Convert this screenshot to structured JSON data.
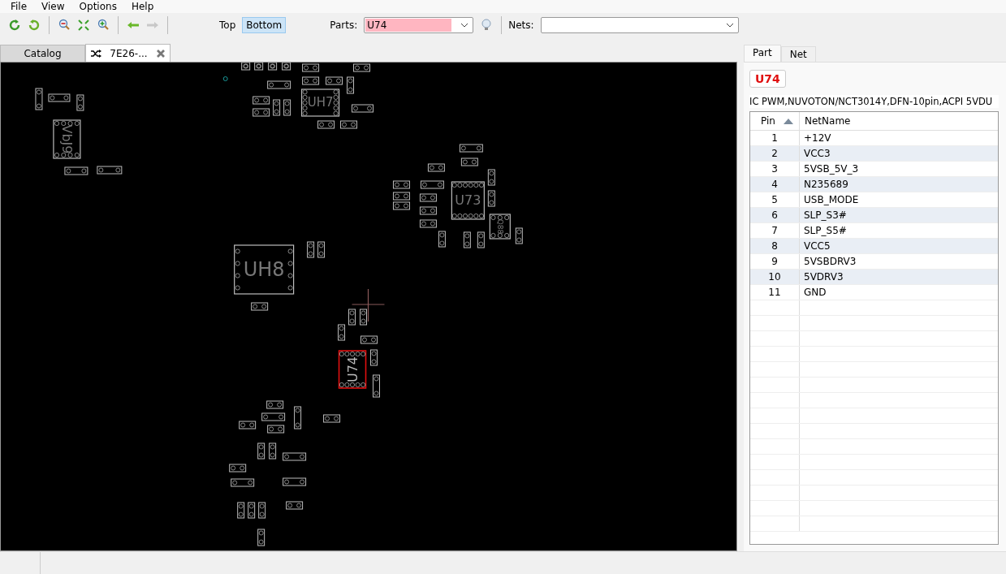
{
  "menu": [
    "File",
    "View",
    "Options",
    "Help"
  ],
  "layer_toggle": [
    {
      "label": "Top",
      "selected": false
    },
    {
      "label": "Bottom",
      "selected": true
    }
  ],
  "parts": {
    "label": "Parts:",
    "value": "U74",
    "highlighted": true
  },
  "nets": {
    "label": "Nets:"
  },
  "tabs": [
    {
      "label": "Catalog",
      "selected": false,
      "closable": false
    },
    {
      "label": "7E26-...",
      "selected": true,
      "closable": true
    }
  ],
  "board": {
    "chips": [
      {
        "label": "VbJ9",
        "selected": false
      },
      {
        "label": "UH7",
        "selected": false
      },
      {
        "label": "U73",
        "selected": false
      },
      {
        "label": "Q88",
        "selected": false
      },
      {
        "label": "UH8",
        "selected": false
      },
      {
        "label": "U74",
        "selected": true
      }
    ]
  },
  "panel": {
    "tabs": [
      {
        "label": "Part",
        "selected": true
      },
      {
        "label": "Net",
        "selected": false
      }
    ],
    "part_name": "U74",
    "description": "IC PWM,NUVOTON/NCT3014Y,DFN-10pin,ACPI 5VDU",
    "columns": [
      "Pin",
      "NetName"
    ],
    "rows": [
      {
        "pin": "1",
        "net": "+12V"
      },
      {
        "pin": "2",
        "net": "VCC3"
      },
      {
        "pin": "3",
        "net": "5VSB_5V_3"
      },
      {
        "pin": "4",
        "net": "N235689"
      },
      {
        "pin": "5",
        "net": "USB_MODE"
      },
      {
        "pin": "6",
        "net": "SLP_S3#"
      },
      {
        "pin": "7",
        "net": "SLP_S5#"
      },
      {
        "pin": "8",
        "net": "VCC5"
      },
      {
        "pin": "9",
        "net": "5VSBDRV3"
      },
      {
        "pin": "10",
        "net": "5VDRV3"
      },
      {
        "pin": "11",
        "net": "GND"
      }
    ]
  }
}
